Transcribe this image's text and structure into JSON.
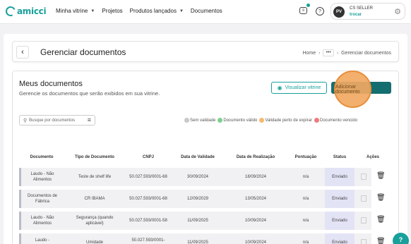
{
  "app": {
    "brand": "amicci"
  },
  "nav": {
    "links": [
      {
        "label": "Minha vitrine",
        "dropdown": true
      },
      {
        "label": "Projetos",
        "dropdown": false
      },
      {
        "label": "Produtos lançados",
        "dropdown": true
      },
      {
        "label": "Documentos",
        "dropdown": false
      }
    ]
  },
  "profile": {
    "initials": "PV",
    "name": "CS SELLER",
    "switch_label": "trocar"
  },
  "header": {
    "back_icon": "chevron-left-icon",
    "title": "Gerenciar documentos",
    "breadcrumb": {
      "home": "Home",
      "more": "•••",
      "current": "Gerenciar documentos"
    }
  },
  "section": {
    "title": "Meus documentos",
    "description": "Gerencie os documentos que serão exibidos em sua vitrine.",
    "view_button": "Visualizar vitrine",
    "add_button": "Adicionar documento"
  },
  "search": {
    "placeholder": "Busque por documentos"
  },
  "legend": [
    {
      "label": "Sem validade",
      "color": "#c8c8c8"
    },
    {
      "label": "Documento válido",
      "color": "#7ed08e"
    },
    {
      "label": "Validade perto de expirar",
      "color": "#f5b971"
    },
    {
      "label": "Documento vencido",
      "color": "#ee7b7b"
    }
  ],
  "table": {
    "columns": [
      "Documento",
      "Tipo de Documento",
      "CNPJ",
      "Data de Validade",
      "Data de Realização",
      "Pontuação",
      "Status",
      "Ações"
    ],
    "rows": [
      {
        "documento": "Laudo - Não Alimentos",
        "tipo": "Teste de shelf life",
        "cnpj": "50.027.593/0001-68",
        "validade": "30/09/2024",
        "realizacao": "18/09/2024",
        "pontuacao": "n/a",
        "status": "Enviado"
      },
      {
        "documento": "Documentos de Fábrica",
        "tipo": "CR IBAMA",
        "cnpj": "50.027.593/0001-68",
        "validade": "12/09/2029",
        "realizacao": "13/05/2024",
        "pontuacao": "n/a",
        "status": "Enviado"
      },
      {
        "documento": "Laudo - Não Alimentos",
        "tipo": "Segurança (quando aplicável)",
        "cnpj": "50.027.593/0001-58",
        "validade": "11/09/2025",
        "realizacao": "10/09/2024",
        "pontuacao": "n/a",
        "status": "Enviado"
      },
      {
        "documento": "Laudo -",
        "tipo": "Umidade",
        "cnpj": "50.027.593/0001-",
        "validade": "11/09/2025",
        "realizacao": "10/09/2024",
        "pontuacao": "n/a",
        "status": "Enviado"
      }
    ]
  },
  "help_fab": {
    "label": "?"
  }
}
